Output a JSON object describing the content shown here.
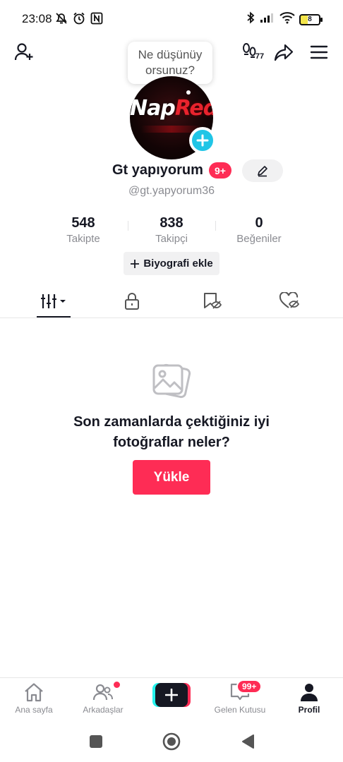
{
  "status_bar": {
    "time": "23:08",
    "battery_level": "8",
    "icons": [
      "mute-icon",
      "alarm-icon",
      "nfc-icon",
      "bluetooth-icon",
      "signal-icon",
      "wifi-icon",
      "battery-icon"
    ]
  },
  "header": {
    "tooltip_line1": "Ne düşünüy",
    "tooltip_line2": "orsunuz?",
    "points_label": "77"
  },
  "profile": {
    "avatar_text_white": "Nap",
    "avatar_text_red": "Red",
    "display_name": "Gt yapıyorum",
    "name_badge": "9+",
    "username": "@gt.yapyorum36"
  },
  "stats": [
    {
      "value": "548",
      "label": "Takipte"
    },
    {
      "value": "838",
      "label": "Takipçi"
    },
    {
      "value": "0",
      "label": "Beğeniler"
    }
  ],
  "bio_button": {
    "label": "Biyografi ekle"
  },
  "tabs": [
    "videos-grid",
    "private",
    "reposts",
    "liked"
  ],
  "empty_state": {
    "title_line1": "Son zamanlarda çektiğiniz iyi",
    "title_line2": "fotoğraflar neler?",
    "button_label": "Yükle"
  },
  "bottom_nav": {
    "home_label": "Ana sayfa",
    "friends_label": "Arkadaşlar",
    "inbox_label": "Gelen Kutusu",
    "inbox_badge": "99+",
    "profile_label": "Profil"
  },
  "colors": {
    "accent": "#fe2c55",
    "cyan": "#25f4ee",
    "text": "#161823",
    "muted": "#8a8b91"
  }
}
